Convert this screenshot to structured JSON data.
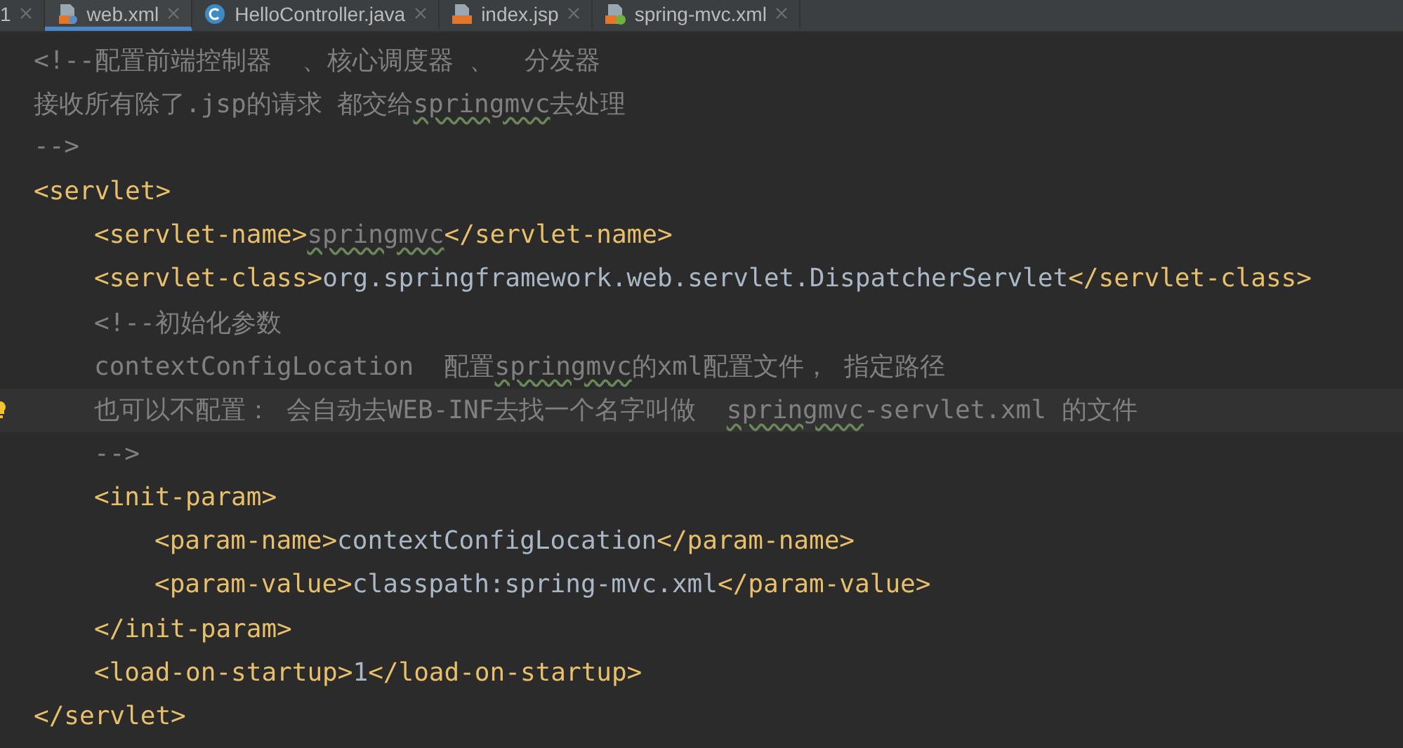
{
  "tabs": [
    {
      "label": "1",
      "kind": "partial",
      "selected": false
    },
    {
      "label": "web.xml",
      "kind": "xml",
      "selected": true
    },
    {
      "label": "HelloController.java",
      "kind": "class",
      "selected": false
    },
    {
      "label": "index.jsp",
      "kind": "jsp",
      "selected": false
    },
    {
      "label": "spring-mvc.xml",
      "kind": "spring",
      "selected": false
    }
  ],
  "lines": [
    {
      "current": false,
      "tokens": [
        {
          "kind": "comment",
          "text": "<!--配置前端控制器  、核心调度器 、  分发器"
        }
      ]
    },
    {
      "current": false,
      "tokens": [
        {
          "kind": "comment",
          "text": "接收所有除了.jsp的请求 都交给"
        },
        {
          "kind": "typo",
          "text": "springmvc"
        },
        {
          "kind": "comment",
          "text": "去处理"
        }
      ]
    },
    {
      "current": false,
      "tokens": [
        {
          "kind": "comment",
          "text": "-->"
        }
      ]
    },
    {
      "current": false,
      "tokens": [
        {
          "kind": "tag",
          "text": "<servlet>"
        }
      ],
      "children": [
        {
          "current": false,
          "tokens": [
            {
              "kind": "tag",
              "text": "<servlet-name>"
            },
            {
              "kind": "typo",
              "text": "springmvc"
            },
            {
              "kind": "tag",
              "text": "</servlet-name>"
            }
          ]
        },
        {
          "current": false,
          "tokens": [
            {
              "kind": "tag",
              "text": "<servlet-class>"
            },
            {
              "kind": "text",
              "text": "org.springframework.web.servlet.DispatcherServlet"
            },
            {
              "kind": "tag",
              "text": "</servlet-class>"
            }
          ]
        },
        {
          "current": false,
          "tokens": [
            {
              "kind": "comment",
              "text": "<!--初始化参数"
            }
          ]
        },
        {
          "current": false,
          "tokens": [
            {
              "kind": "comment",
              "text": "contextConfigLocation  配置"
            },
            {
              "kind": "typo",
              "text": "springmvc"
            },
            {
              "kind": "comment",
              "text": "的xml配置文件， 指定路径"
            }
          ]
        },
        {
          "current": true,
          "tokens": [
            {
              "kind": "comment",
              "text": "也可以不配置： 会自动去WEB-INF去找一个名字叫做  "
            },
            {
              "kind": "typo",
              "text": "springmvc"
            },
            {
              "kind": "comment",
              "text": "-servlet.xml 的文件"
            }
          ]
        },
        {
          "current": false,
          "tokens": [
            {
              "kind": "comment",
              "text": "-->"
            }
          ]
        },
        {
          "current": false,
          "tokens": [
            {
              "kind": "tag",
              "text": "<init-param>"
            }
          ],
          "children": [
            {
              "current": false,
              "tokens": [
                {
                  "kind": "tag",
                  "text": "<param-name>"
                },
                {
                  "kind": "text",
                  "text": "contextConfigLocation"
                },
                {
                  "kind": "tag",
                  "text": "</param-name>"
                }
              ]
            },
            {
              "current": false,
              "tokens": [
                {
                  "kind": "tag",
                  "text": "<param-value>"
                },
                {
                  "kind": "text",
                  "text": "classpath:spring-mvc.xml"
                },
                {
                  "kind": "tag",
                  "text": "</param-value>"
                }
              ]
            }
          ]
        },
        {
          "current": false,
          "tokens": [
            {
              "kind": "tag",
              "text": "</init-param>"
            }
          ]
        },
        {
          "current": false,
          "tokens": [
            {
              "kind": "tag",
              "text": "<load-on-startup>"
            },
            {
              "kind": "text",
              "text": "1"
            },
            {
              "kind": "tag",
              "text": "</load-on-startup>"
            }
          ]
        }
      ]
    },
    {
      "current": false,
      "tokens": [
        {
          "kind": "tag",
          "text": "</servlet>"
        }
      ]
    }
  ]
}
